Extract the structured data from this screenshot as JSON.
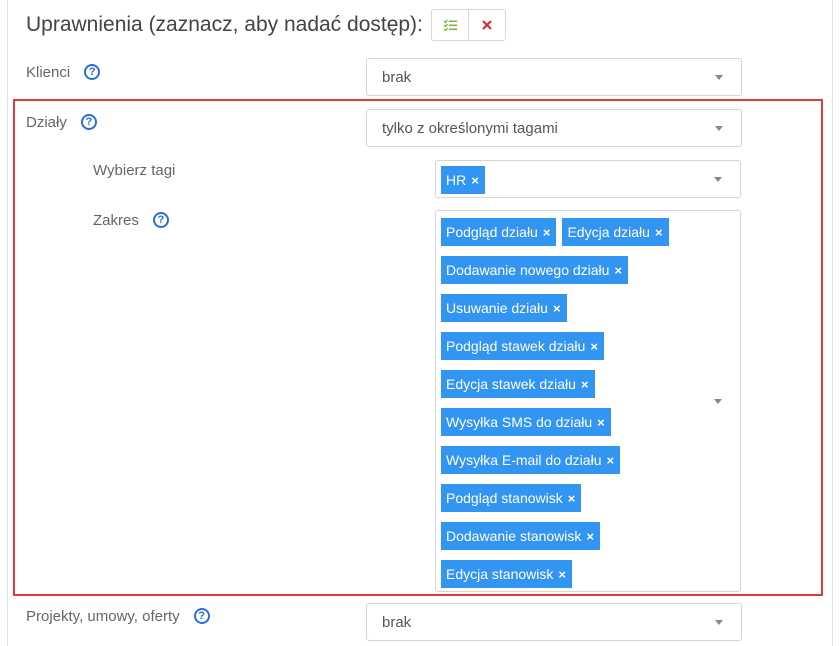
{
  "header": {
    "title": "Uprawnienia (zaznacz, aby nadać dostęp):"
  },
  "rows": {
    "klienci": {
      "label": "Klienci",
      "value": "brak"
    },
    "dzialy": {
      "label": "Działy",
      "value": "tylko z określonymi tagami"
    },
    "wybierz_tagi": {
      "label": "Wybierz tagi",
      "tags": [
        "HR"
      ]
    },
    "zakres": {
      "label": "Zakres",
      "tags": [
        "Podgląd działu",
        "Edycja działu",
        "Dodawanie nowego działu",
        "Usuwanie działu",
        "Podgląd stawek działu",
        "Edycja stawek działu",
        "Wysyłka SMS do działu",
        "Wysyłka E-mail do działu",
        "Podgląd stanowisk",
        "Dodawanie stanowisk",
        "Edycja stanowisk"
      ]
    },
    "projekty": {
      "label": "Projekty, umowy, oferty",
      "value": "brak"
    }
  },
  "icons": {
    "help": "?",
    "remove": "×",
    "check_all": "check-list-icon",
    "clear_all": "close-icon"
  },
  "colors": {
    "tag_bg": "#3295f2",
    "help_blue": "#2a6fd6",
    "highlight_red": "#e53935",
    "check_green": "#7cb342",
    "clear_red": "#d32f2f"
  }
}
